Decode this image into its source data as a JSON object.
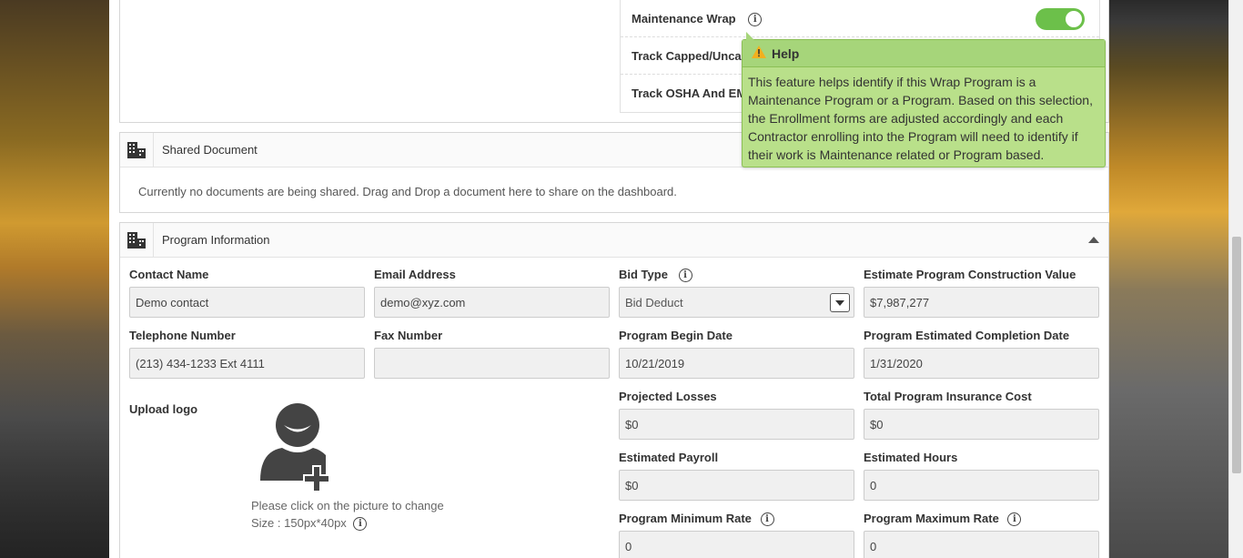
{
  "top_card": {
    "toggles": [
      {
        "label": "Maintenance Wrap"
      },
      {
        "label": "Track Capped/Uncap"
      },
      {
        "label": "Track OSHA And EMR"
      }
    ]
  },
  "tooltip": {
    "title": "Help",
    "body": "This feature helps identify if this Wrap Program is a Maintenance Program or a Program. Based on this selection, the Enrollment forms are adjusted accordingly and each Contractor enrolling into the Program will need to identify if their work is Maintenance related or Program based."
  },
  "shared_document": {
    "title": "Shared Document",
    "message": "Currently no documents are being shared. Drag and Drop a document here to share on the dashboard."
  },
  "program_information": {
    "title": "Program Information",
    "contact_name": {
      "label": "Contact Name",
      "value": "Demo contact"
    },
    "email": {
      "label": "Email Address",
      "value": "demo@xyz.com"
    },
    "bid_type": {
      "label": "Bid Type",
      "value": "Bid Deduct"
    },
    "construction_value": {
      "label": "Estimate Program Construction Value",
      "value": "$7,987,277"
    },
    "telephone": {
      "label": "Telephone Number",
      "value": "(213) 434-1233 Ext 4111"
    },
    "fax": {
      "label": "Fax Number",
      "value": ""
    },
    "begin_date": {
      "label": "Program Begin Date",
      "value": "10/21/2019"
    },
    "completion_date": {
      "label": "Program Estimated Completion Date",
      "value": "1/31/2020"
    },
    "upload_logo": {
      "label": "Upload logo",
      "hint": "Please click on the picture to change",
      "size": "Size : 150px*40px"
    },
    "projected_losses": {
      "label": "Projected Losses",
      "value": "$0"
    },
    "insurance_cost": {
      "label": "Total Program Insurance Cost",
      "value": "$0"
    },
    "estimated_payroll": {
      "label": "Estimated Payroll",
      "value": "$0"
    },
    "estimated_hours": {
      "label": "Estimated Hours",
      "value": "0"
    },
    "minimum_rate": {
      "label": "Program Minimum Rate",
      "value": "0"
    },
    "maximum_rate": {
      "label": "Program Maximum Rate",
      "value": "0"
    }
  }
}
